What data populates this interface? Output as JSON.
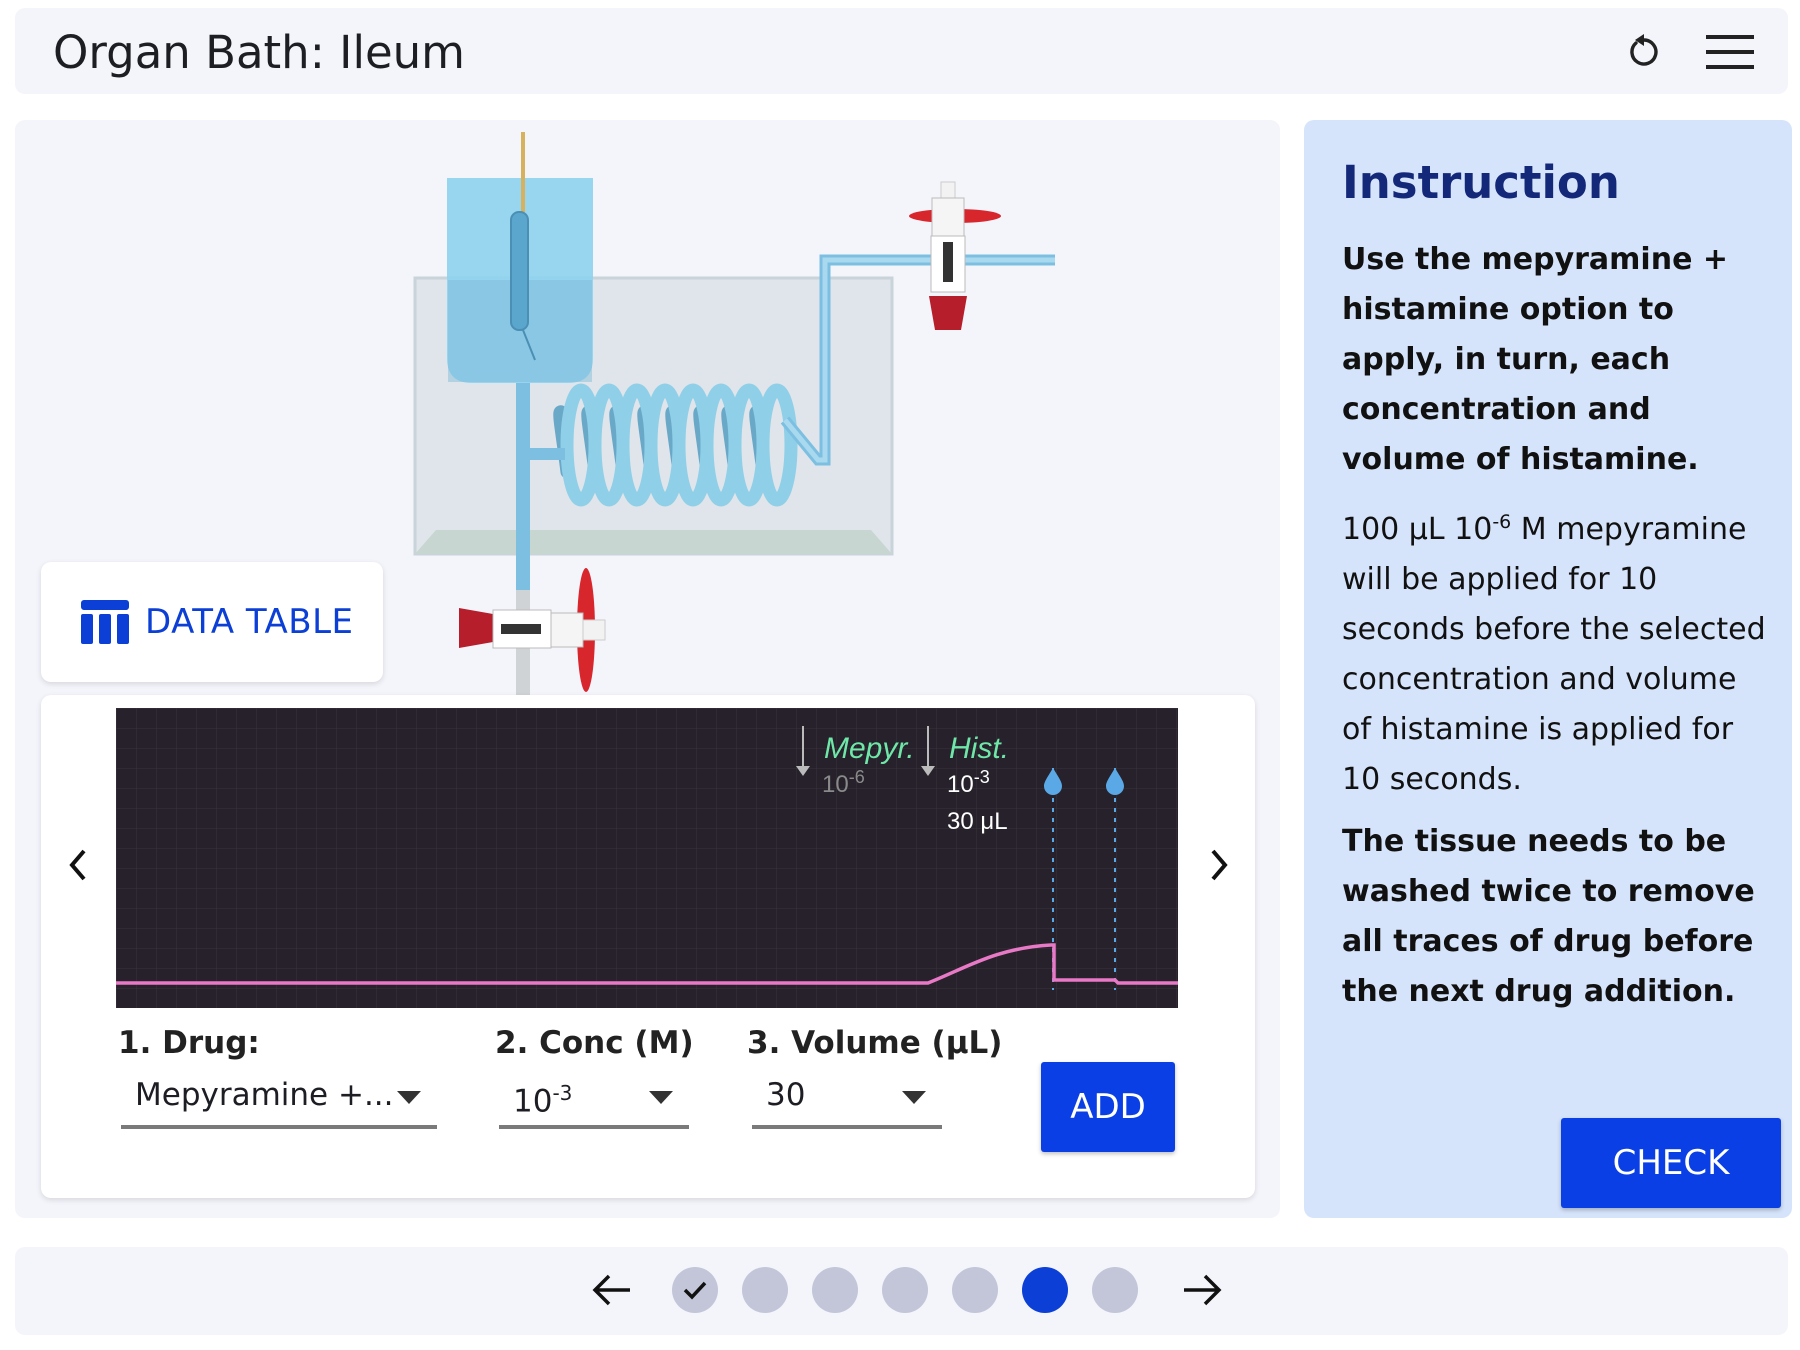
{
  "header": {
    "title": "Organ Bath: Ileum",
    "icons": [
      "reset-icon",
      "menu-icon"
    ]
  },
  "apparatus": {
    "data_table_label": "DATA TABLE"
  },
  "trace": {
    "markers": {
      "mepyr_label": "Mepyr.",
      "mepyr_conc_base": "10",
      "mepyr_conc_exp": "-6",
      "hist_label": "Hist.",
      "hist_conc_base": "10",
      "hist_conc_exp": "-3",
      "hist_volume": "30 μL"
    },
    "colors": {
      "background": "#26212a",
      "trace": "#e879c6",
      "drug_label": "#6ee7a8",
      "wash_marker": "#5aa8e6"
    }
  },
  "controls": {
    "drug_label": "1. Drug:",
    "drug_value": "Mepyramine +...",
    "conc_label": "2. Conc (M)",
    "conc_value_base": "10",
    "conc_value_exp": "-3",
    "volume_label": "3. Volume (μL)",
    "volume_value": "30",
    "add_label": "ADD"
  },
  "instruction": {
    "title": "Instruction",
    "paragraph1": "Use the mepyramine + histamine option to apply, in turn, each concentration and volume of histamine.",
    "p2_part1": "100 μL 10",
    "p2_exp": "-6",
    "p2_part2": " M mepyramine will be applied for 10 seconds before the selected concentration and volume of histamine is applied for 10 seconds.",
    "paragraph3": "The tissue needs to be washed twice to remove all traces of drug before the next drug addition.",
    "check_label": "CHECK"
  },
  "footer": {
    "steps": [
      {
        "state": "completed"
      },
      {
        "state": "pending"
      },
      {
        "state": "pending"
      },
      {
        "state": "pending"
      },
      {
        "state": "pending"
      },
      {
        "state": "current"
      },
      {
        "state": "pending"
      }
    ],
    "icons": [
      "arrow-left-icon",
      "arrow-right-icon",
      "check-icon"
    ]
  },
  "colors": {
    "accent": "#0b3fe6",
    "panel": "#f4f4fb",
    "instruction_bg": "#d6e4fb",
    "title_blue": "#14287a"
  }
}
